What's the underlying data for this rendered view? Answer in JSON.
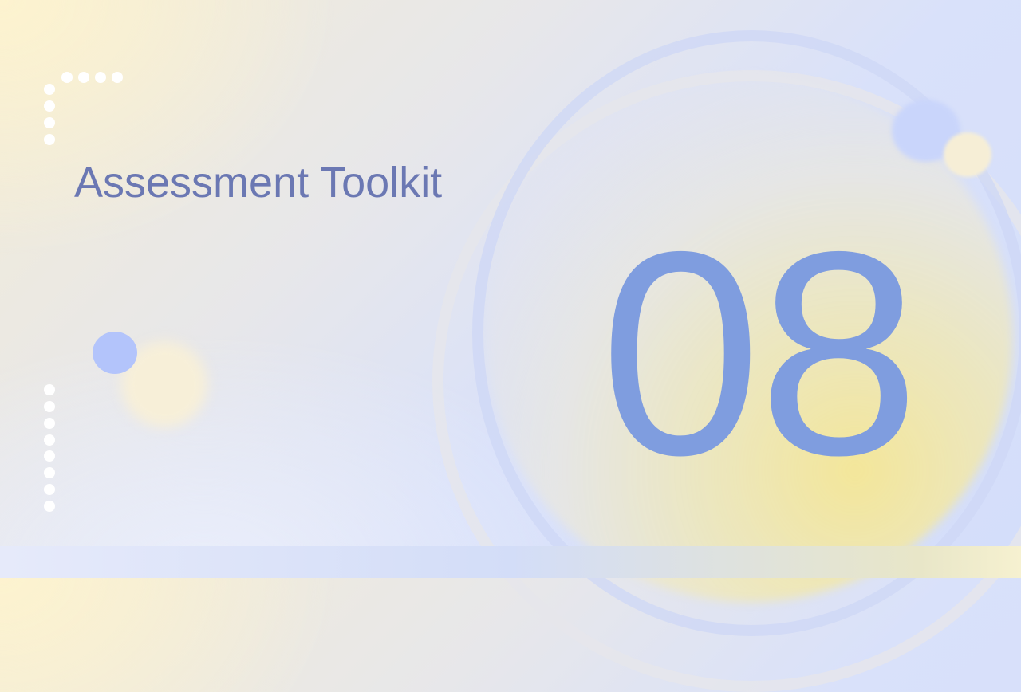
{
  "slide": {
    "title": "Assessment Toolkit",
    "section_number": "08"
  },
  "colors": {
    "title": "#6b78b3",
    "number": "#7f9ddf",
    "accent_blue": "#b3c4fb",
    "accent_cream": "#f6efd8"
  }
}
